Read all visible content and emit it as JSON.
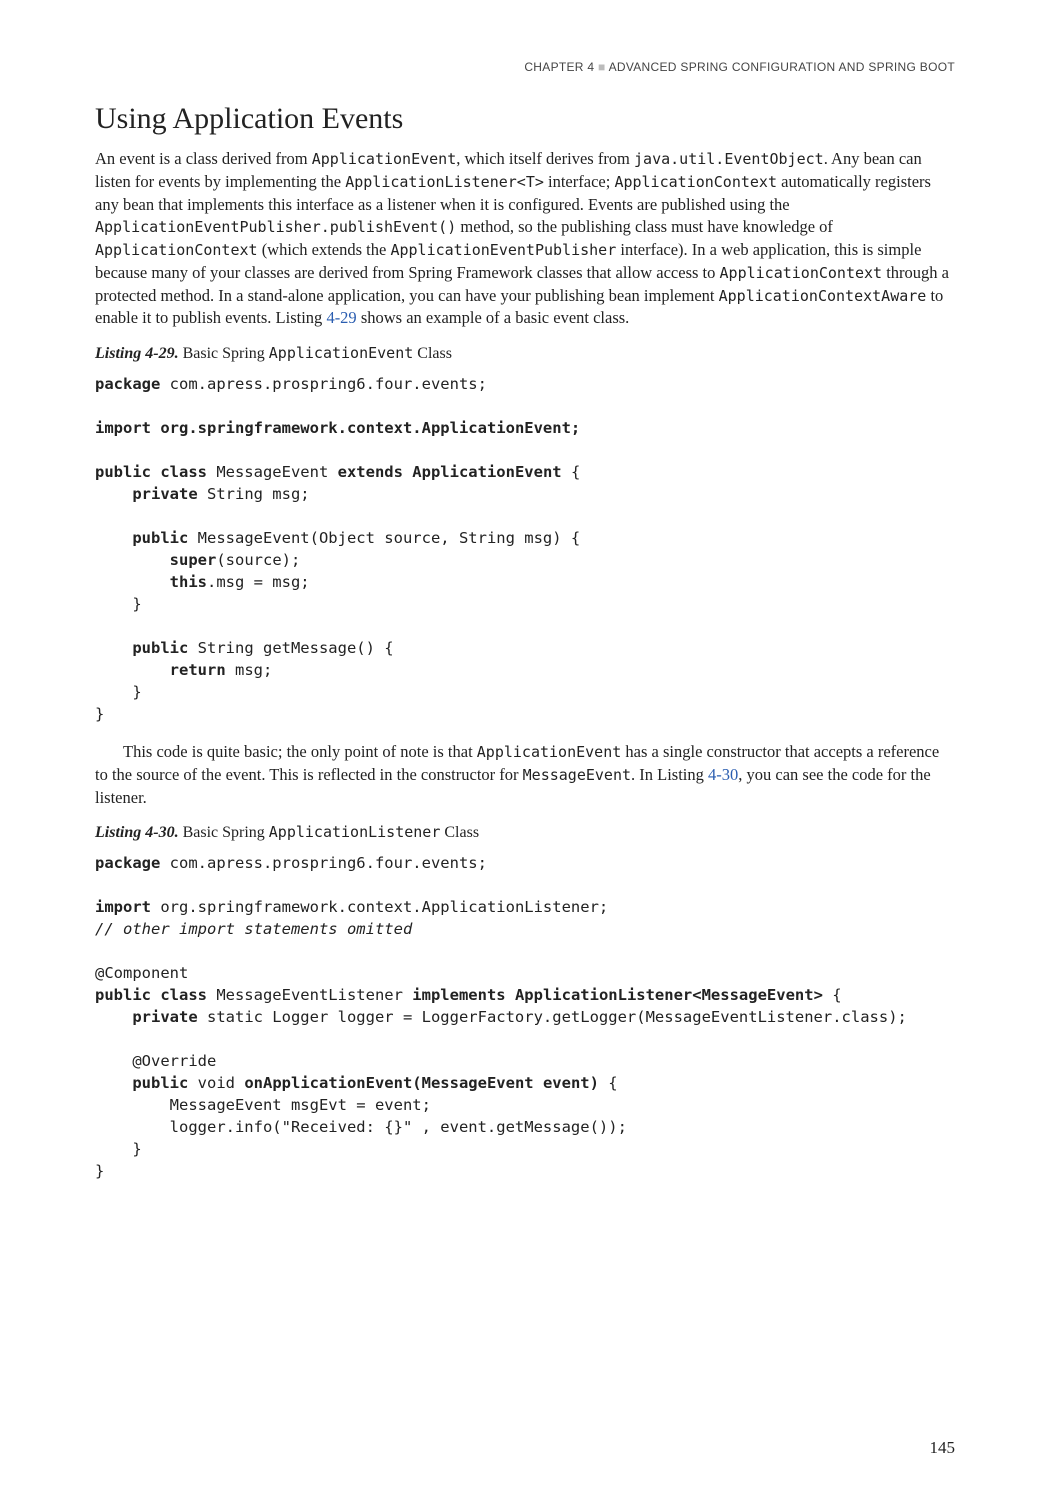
{
  "header": {
    "chapter_label": "CHAPTER 4",
    "chapter_title": "ADVANCED SPRING CONFIGURATION AND SPRING BOOT"
  },
  "section": {
    "title": "Using Application Events"
  },
  "para1": {
    "t1": "An event is a class derived from ",
    "c1": "ApplicationEvent",
    "t2": ", which itself derives from ",
    "c2": "java.util.EventObject",
    "t3": ". Any bean can listen for events by implementing the ",
    "c3": "ApplicationListener<T>",
    "t4": " interface; ",
    "c4": "ApplicationContext",
    "t5": " automatically registers any bean that implements this interface as a listener when it is configured. Events are published using the ",
    "c5": "ApplicationEventPublisher.publishEvent()",
    "t6": " method, so the publishing class must have knowledge of ",
    "c6": "ApplicationContext",
    "t7": " (which extends the ",
    "c7": "ApplicationEventPublisher",
    "t8": " interface). In a web application, this is simple because many of your classes are derived from Spring Framework classes that allow access to ",
    "c8": "ApplicationContext",
    "t9": " through a protected method. In a stand-alone application, you can have your publishing bean implement ",
    "c9": "ApplicationContextAware",
    "t10": " to enable it to publish events. Listing ",
    "link": "4-29",
    "t11": " shows an example of a basic event class."
  },
  "listing29": {
    "label": "Listing 4-29.",
    "caption_t1": "  Basic Spring ",
    "caption_c1": "ApplicationEvent",
    "caption_t2": " Class",
    "l1a": "package",
    "l1b": " com.apress.prospring6.four.events;",
    "l2a": "import",
    "l2b": " org.springframework.context.ApplicationEvent;",
    "l3a": "public class",
    "l3b": " MessageEvent ",
    "l3c": "extends",
    "l3d": " ApplicationEvent",
    "l3e": " {",
    "l4a": "private",
    "l4b": " String msg;",
    "l5a": "public",
    "l5b": " MessageEvent(Object source, String msg) {",
    "l6a": "super",
    "l6b": "(source);",
    "l7a": "this",
    "l7b": ".msg = msg;",
    "l8": "}",
    "l9a": "public",
    "l9b": " String getMessage() {",
    "l10a": "return",
    "l10b": " msg;",
    "l11": "}",
    "l12": "}"
  },
  "para2": {
    "t1": "This code is quite basic; the only point of note is that ",
    "c1": "ApplicationEvent",
    "t2": " has a single constructor that accepts a reference to the source of the event. This is reflected in the constructor for ",
    "c2": "MessageEvent",
    "t3": ". In Listing ",
    "link": "4-30",
    "t4": ", you can see the code for the listener."
  },
  "listing30": {
    "label": "Listing 4-30.",
    "caption_t1": "  Basic Spring ",
    "caption_c1": "ApplicationListener",
    "caption_t2": " Class",
    "l1a": "package",
    "l1b": " com.apress.prospring6.four.events;",
    "l2a": "import",
    "l2b": " org.springframework.context.ApplicationListener;",
    "l3": "// other import statements omitted",
    "l4": "@Component",
    "l5a": "public class",
    "l5b": " MessageEventListener ",
    "l5c": "implements",
    "l5d": " ApplicationListener<MessageEvent>",
    "l5e": " {",
    "l6a": "private",
    "l6b": " static Logger logger = LoggerFactory.getLogger(MessageEventListener.class);",
    "l7": "@Override",
    "l8a": "public",
    "l8b": " void ",
    "l8c": "onApplicationEvent(MessageEvent event)",
    "l8d": " {",
    "l9": "MessageEvent msgEvt = event;",
    "l10": "logger.info(\"Received: {}\" , event.getMessage());",
    "l11": "}",
    "l12": "}"
  },
  "page_number": "145"
}
